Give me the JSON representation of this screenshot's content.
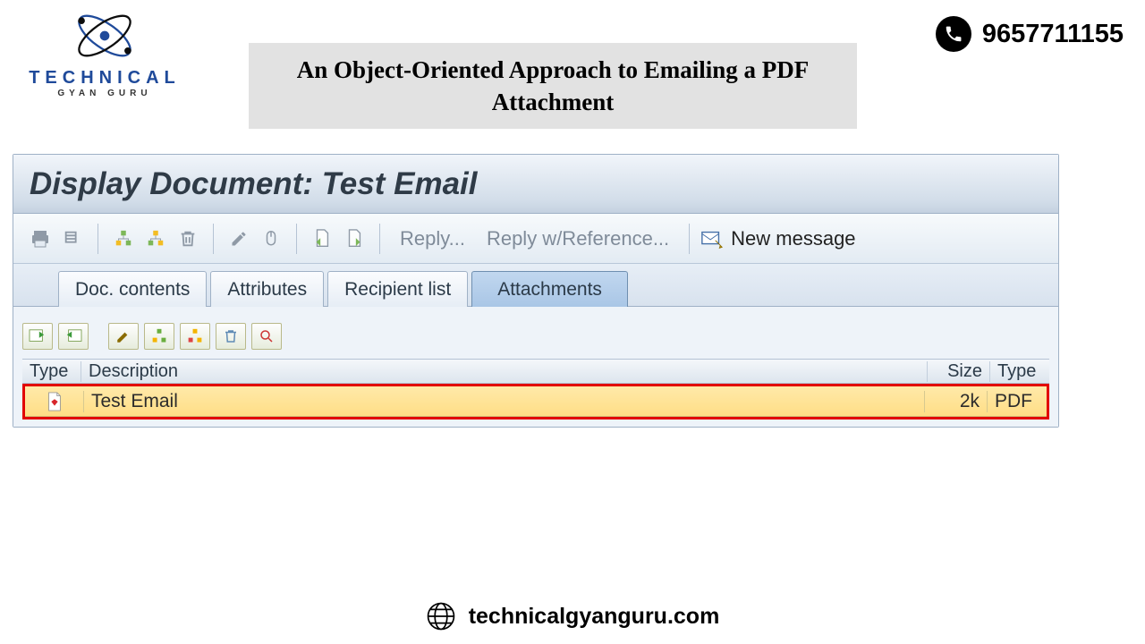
{
  "branding": {
    "logo_text": "TECHNICAL",
    "logo_subtext": "GYAN GURU",
    "phone_number": "9657711155",
    "website": "technicalgyanguru.com"
  },
  "page_title": "An Object-Oriented Approach to Emailing a PDF Attachment",
  "sap": {
    "window_title": "Display Document: Test Email",
    "toolbar": {
      "reply": "Reply...",
      "reply_ref": "Reply w/Reference...",
      "new_message": "New message"
    },
    "tabs": {
      "doc_contents": "Doc. contents",
      "attributes": "Attributes",
      "recipient_list": "Recipient list",
      "attachments": "Attachments"
    },
    "table": {
      "headers": {
        "type": "Type",
        "description": "Description",
        "size": "Size",
        "type2": "Type"
      },
      "rows": [
        {
          "icon": "pdf",
          "description": "Test Email",
          "size": "2k",
          "filetype": "PDF"
        }
      ]
    }
  }
}
